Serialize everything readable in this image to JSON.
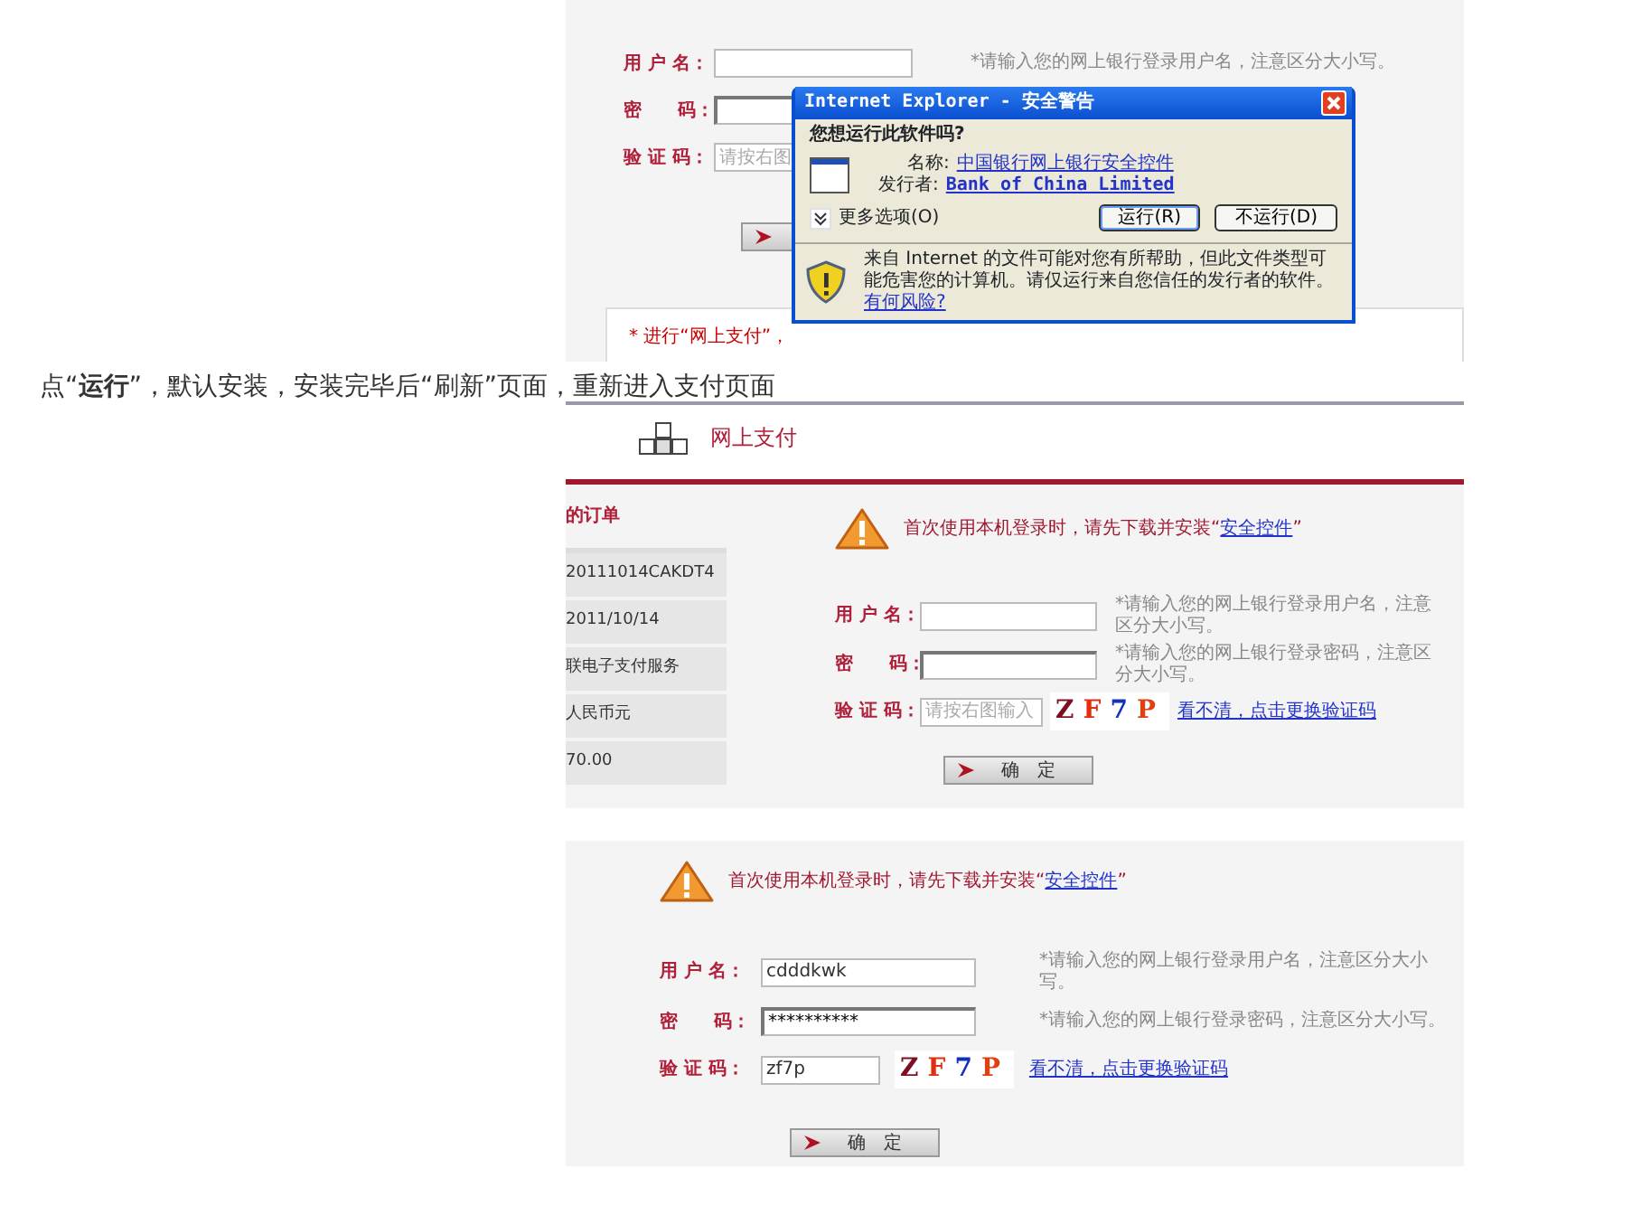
{
  "screenshot_1": {
    "form": {
      "rows": [
        {
          "kind": "text",
          "label": "用 户 名：",
          "hint": "*请输入您的网上银行登录用户名，注意区分大小写。"
        },
        {
          "kind": "password",
          "label": "密　　码："
        },
        {
          "kind": "captcha",
          "label": "验 证 码：",
          "placeholder": "请按右图"
        }
      ]
    },
    "notice": "* 进行“网上支付”，",
    "dialog": {
      "title": "Internet Explorer - 安全警告",
      "question": "您想运行此软件吗?",
      "name_label": "名称:",
      "name_value": "中国银行网上银行安全控件",
      "publisher_label": "发行者:",
      "publisher_value": "Bank of China Limited",
      "more_options": "更多选项(O)",
      "buttons": [
        {
          "label": "运行(R)",
          "selected": true
        },
        {
          "label": "不运行(D)",
          "selected": false
        }
      ],
      "warning": "来自 Internet 的文件可能对您有所帮助，但此文件类型可能危害您的计算机。请仅运行来自您信任的发行者的软件。",
      "risk_link": "有何风险?"
    }
  },
  "caption": "点“**运行**”，默认安装，安装完毕后“刷新”页面，重新进入支付页面",
  "screenshot_2": {
    "header": "网上支付",
    "sidebar": {
      "title": "的订单",
      "items": [
        "20111014CAKDT4",
        "2011/10/14",
        "联电子支付服务",
        "人民币元",
        "70.00"
      ]
    },
    "notice": {
      "text": "首次使用本机登录时，请先下载并安装“",
      "link": "安全控件",
      "end": "”"
    },
    "form": {
      "rows": [
        {
          "kind": "text",
          "label": "用 户 名：",
          "hint": "*请输入您的网上银行登录用户名，注意区分大小写。"
        },
        {
          "kind": "password",
          "label": "密　　码：",
          "hint": "*请输入您的网上银行登录密码，注意区分大小写。"
        },
        {
          "kind": "captcha",
          "label": "验 证 码：",
          "placeholder": "请按右图输入",
          "captcha": "ZF7P",
          "link": "看不清，点击更换验证码"
        }
      ],
      "button": "确　定"
    }
  },
  "screenshot_3": {
    "notice": {
      "text": "首次使用本机登录时，请先下载并安装“",
      "link": "安全控件",
      "end": "”"
    },
    "form": {
      "rows": [
        {
          "kind": "text",
          "label": "用 户 名：",
          "value": "cdddkwk",
          "hint": "*请输入您的网上银行登录用户名，注意区分大小写。"
        },
        {
          "kind": "password",
          "label": "密　　码：",
          "value": "**********",
          "hint": "*请输入您的网上银行登录密码，注意区分大小写。"
        },
        {
          "kind": "captcha",
          "label": "验 证 码：",
          "value": "zf7p",
          "captcha": "ZF7P",
          "link": "看不清，点击更换验证码"
        }
      ],
      "button": "确　定"
    }
  }
}
